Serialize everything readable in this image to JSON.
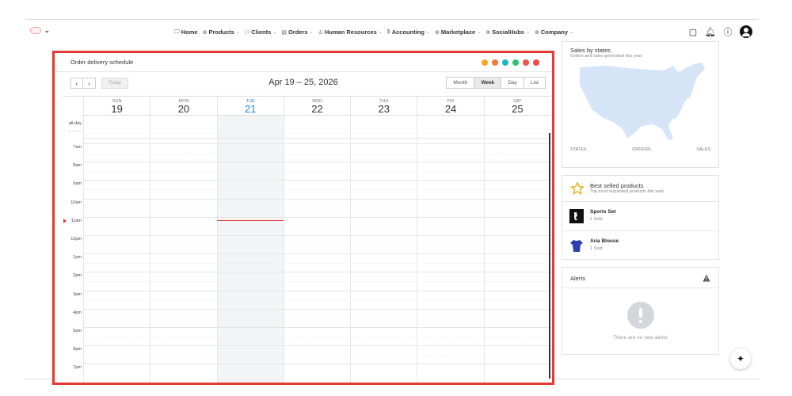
{
  "nav": {
    "items": [
      {
        "label": "Home",
        "icon": "monitor-icon",
        "glyph": "🖵",
        "has_menu": false
      },
      {
        "label": "Products",
        "icon": "globe-icon",
        "glyph": "⊕",
        "has_menu": true
      },
      {
        "label": "Clients",
        "icon": "users-icon",
        "glyph": "⚇",
        "has_menu": true
      },
      {
        "label": "Orders",
        "icon": "calendar-icon",
        "glyph": "▤",
        "has_menu": true
      },
      {
        "label": "Human Resources",
        "icon": "person-icon",
        "glyph": "♙",
        "has_menu": true
      },
      {
        "label": "Accounting",
        "icon": "dollar-icon",
        "glyph": "$",
        "has_menu": true
      },
      {
        "label": "Marketplace",
        "icon": "globe-icon",
        "glyph": "⊕",
        "has_menu": true
      },
      {
        "label": "SocialHubs",
        "icon": "globe-icon",
        "glyph": "⊕",
        "has_menu": true
      },
      {
        "label": "Company",
        "icon": "globe-icon",
        "glyph": "⊕",
        "has_menu": true
      }
    ]
  },
  "calendar": {
    "title": "Order delivery schedule",
    "dot_colors": [
      "#f5a623",
      "#f07c3c",
      "#1fb6c9",
      "#2ec46f",
      "#f0524f",
      "#ee4a4a"
    ],
    "prev_glyph": "‹",
    "next_glyph": "›",
    "today_label": "Today",
    "range": "Apr 19 – 25, 2026",
    "views": [
      "Month",
      "Week",
      "Day",
      "List"
    ],
    "active_view": "Week",
    "days": [
      {
        "name": "SUN",
        "date": "19",
        "today": false
      },
      {
        "name": "MON",
        "date": "20",
        "today": false
      },
      {
        "name": "TUE",
        "date": "21",
        "today": true
      },
      {
        "name": "WED",
        "date": "22",
        "today": false
      },
      {
        "name": "THU",
        "date": "23",
        "today": false
      },
      {
        "name": "FRI",
        "date": "24",
        "today": false
      },
      {
        "name": "SAT",
        "date": "25",
        "today": false
      }
    ],
    "allday_label": "all-day",
    "allday_sub": "– – – –",
    "times": [
      "7am",
      "8am",
      "9am",
      "10am",
      "11am",
      "12pm",
      "1pm",
      "2pm",
      "3pm",
      "4pm",
      "5pm",
      "6pm",
      "7pm"
    ],
    "now_time_index": 4
  },
  "sales": {
    "title": "Sales by states",
    "subtitle": "Orders and sales generated this year",
    "columns": [
      "STATES",
      "ORDERS",
      "SALES"
    ],
    "map_color": "#d6e4f7"
  },
  "best": {
    "title": "Best selled products",
    "subtitle": "Top most requested products this year",
    "products": [
      {
        "name": "Sports Set",
        "sold": "1 Sold"
      },
      {
        "name": "Aria Blouse",
        "sold": "1 Sold"
      }
    ]
  },
  "alerts": {
    "title": "Alerts",
    "empty_text": "There are no new alerts"
  }
}
